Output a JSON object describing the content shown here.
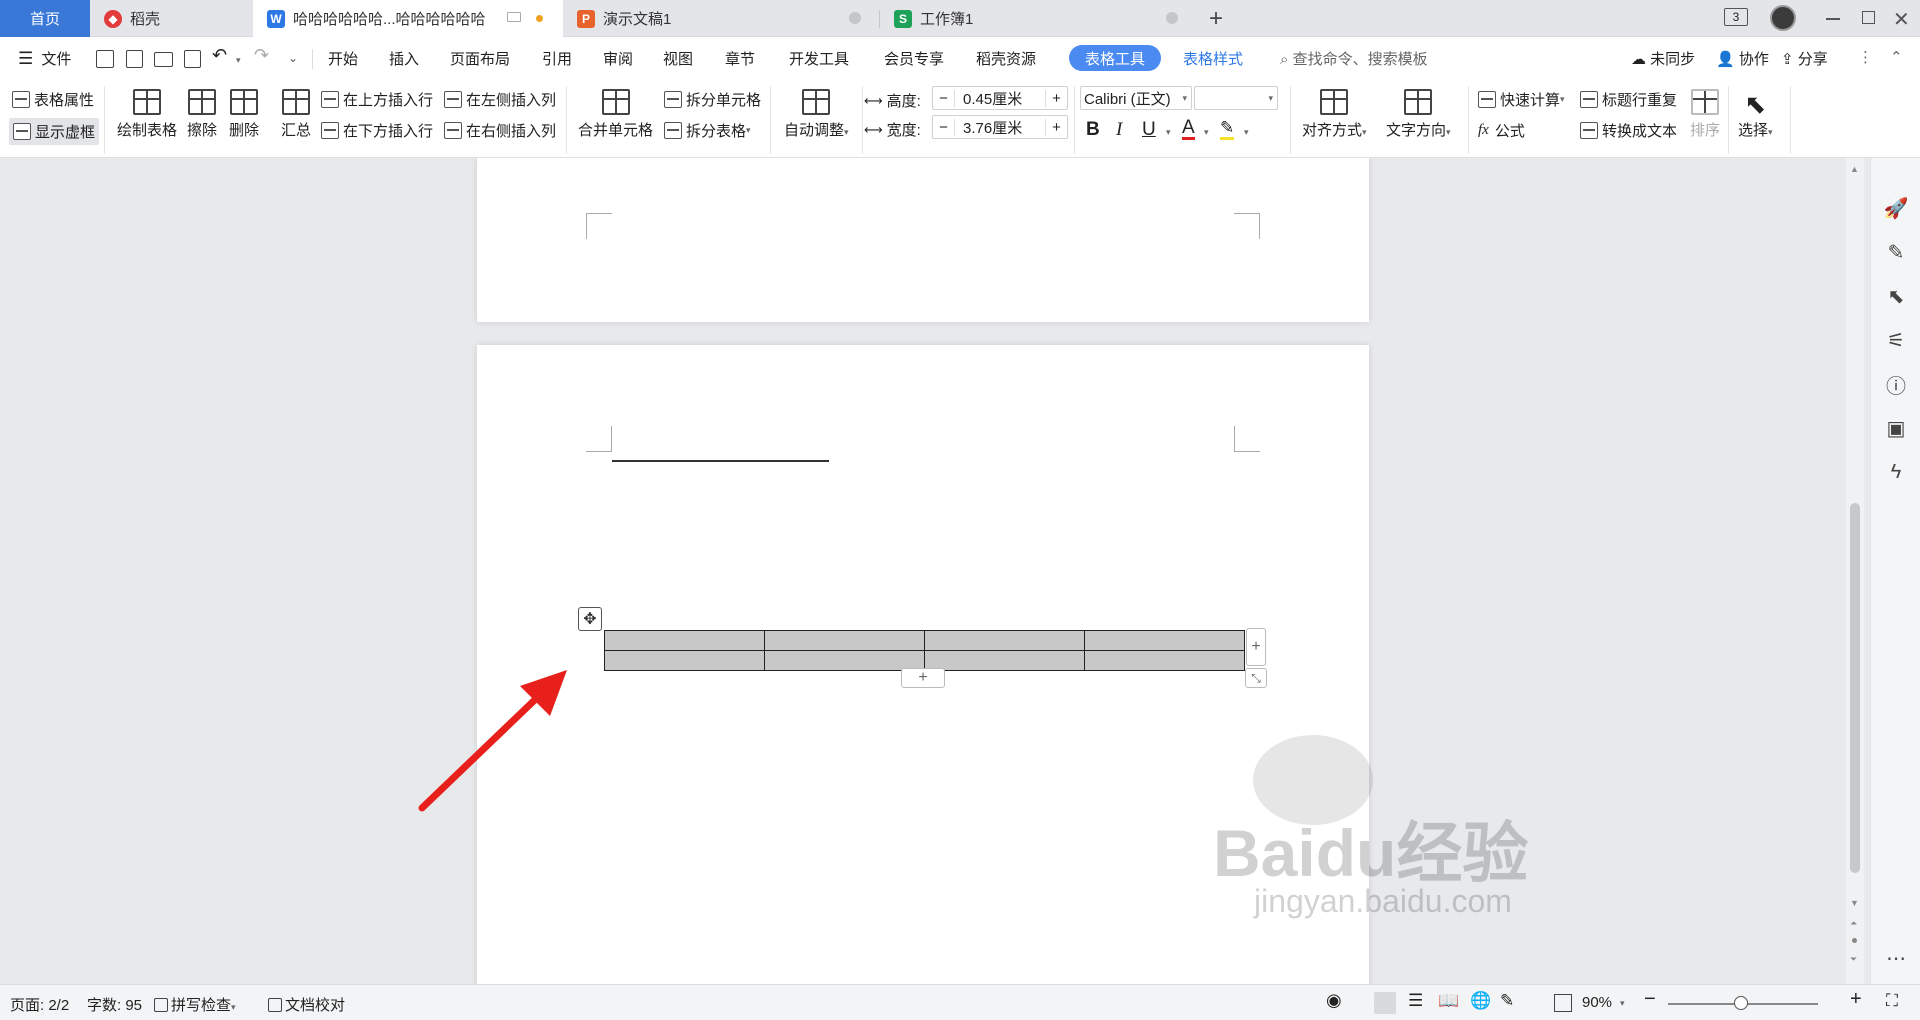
{
  "tabs": [
    {
      "label": "首页",
      "icon": "home-tab",
      "color": "#3a78d8"
    },
    {
      "label": "稻壳",
      "icon": "docer-icon",
      "color": "#e23b3b"
    },
    {
      "label": "哈哈哈哈哈哈...哈哈哈哈哈哈",
      "icon": "writer-icon",
      "color": "#2e78e6"
    },
    {
      "label": "演示文稿1",
      "icon": "presentation-icon",
      "color": "#e8622c"
    },
    {
      "label": "工作簿1",
      "icon": "spreadsheet-icon",
      "color": "#1ea25a"
    }
  ],
  "window": {
    "count_badge": "3"
  },
  "menu": {
    "file": "文件",
    "items": [
      "开始",
      "插入",
      "页面布局",
      "引用",
      "审阅",
      "视图",
      "章节",
      "开发工具",
      "会员专享",
      "稻壳资源"
    ],
    "active": "表格工具",
    "table_style": "表格样式",
    "search": "查找命令、搜索模板",
    "sync": "未同步",
    "collab": "协作",
    "share": "分享"
  },
  "ribbon": {
    "table_props": "表格属性",
    "show_gridlines": "显示虚框",
    "draw_table": "绘制表格",
    "erase": "擦除",
    "delete": "删除",
    "summary": "汇总",
    "insert_above": "在上方插入行",
    "insert_below": "在下方插入行",
    "insert_left": "在左侧插入列",
    "insert_right": "在右侧插入列",
    "merge_cells": "合并单元格",
    "split_cells": "拆分单元格",
    "split_table": "拆分表格",
    "auto_fit": "自动调整",
    "height_label": "高度:",
    "height_value": "0.45厘米",
    "width_label": "宽度:",
    "width_value": "3.76厘米",
    "font_name": "Calibri (正文)",
    "font_size": "",
    "align": "对齐方式",
    "text_dir": "文字方向",
    "quick_calc": "快速计算",
    "repeat_title": "标题行重复",
    "formula": "公式",
    "to_text": "转换成文本",
    "sort": "排序",
    "select": "选择"
  },
  "document": {
    "table_rows": 2,
    "table_cols": 4
  },
  "status": {
    "page": "页面: 2/2",
    "words": "字数: 95",
    "spell": "拼写检查",
    "proof": "文档校对",
    "zoom": "90%"
  },
  "watermark": {
    "brand": "Baidu经验",
    "url": "jingyan.baidu.com"
  },
  "colors": {
    "accent": "#2e78e6",
    "annotation_arrow": "#e8201b"
  }
}
